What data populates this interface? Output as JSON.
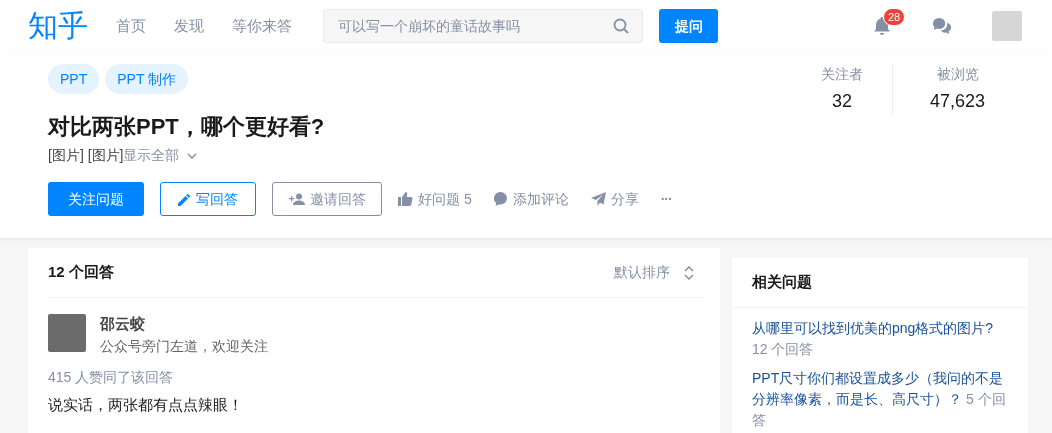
{
  "header": {
    "logo": "知乎",
    "nav": [
      {
        "label": "首页",
        "selected": false
      },
      {
        "label": "发现",
        "selected": false
      },
      {
        "label": "等你来答",
        "selected": false
      }
    ],
    "search": {
      "placeholder": "可以写一个崩坏的童话故事吗"
    },
    "ask_button": "提问",
    "notification_count": "28"
  },
  "question": {
    "topics": [
      "PPT",
      "PPT 制作"
    ],
    "title": "对比两张PPT，哪个更好看?",
    "excerpt": "[图片] [图片]",
    "show_all": "显示全部",
    "stats": [
      {
        "label": "关注者",
        "value": "32"
      },
      {
        "label": "被浏览",
        "value": "47,623"
      }
    ],
    "actions": [
      {
        "kind": "primary",
        "label": "关注问题"
      },
      {
        "kind": "outline",
        "label": "写回答"
      },
      {
        "kind": "gray",
        "label": "邀请回答"
      },
      {
        "kind": "plain",
        "label": "好问题 5"
      },
      {
        "kind": "plain",
        "label": "添加评论"
      },
      {
        "kind": "plain",
        "label": "分享"
      },
      {
        "kind": "more",
        "label": "···"
      }
    ]
  },
  "answers": {
    "count": "12 个回答",
    "sort": "默认排序",
    "items": [
      {
        "author": "邵云蛟",
        "bio": "公众号旁门左道，欢迎关注",
        "votes": "415 人赞同了该回答",
        "content": "说实话，两张都有点点辣眼！"
      }
    ]
  },
  "related": {
    "title": "相关问题",
    "items": [
      {
        "question": "从哪里可以找到优美的png格式的图片?",
        "answers": "12 个回答"
      },
      {
        "question": "PPT尺寸你们都设置成多少（我问的不是分辨率像素，而是长、高尺寸）？",
        "answers": "5 个回答"
      }
    ]
  }
}
